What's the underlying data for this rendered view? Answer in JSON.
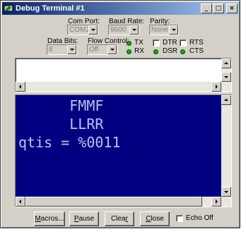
{
  "window": {
    "title": "Debug Terminal #1",
    "controls": {
      "minimize": "_",
      "maximize": "□",
      "close": "×"
    }
  },
  "settings": {
    "com_port": {
      "label": "Com Port:",
      "value": "COM2"
    },
    "baud_rate": {
      "label": "Baud Rate:",
      "value": "9600"
    },
    "parity": {
      "label": "Parity:",
      "value": "None"
    },
    "data_bits": {
      "label": "Data Bits:",
      "value": "8"
    },
    "flow_control": {
      "label": "Flow Control:",
      "value": "Off"
    }
  },
  "indicators": {
    "tx": "TX",
    "rx": "RX",
    "dsr": "DSR",
    "cts": "CTS",
    "led_color": "#00b000"
  },
  "lines": {
    "dtr": "DTR",
    "rts": "RTS"
  },
  "terminal": {
    "background": "#000080",
    "lines": [
      "      FMMF",
      "      LLRR",
      "qtis = %0011"
    ]
  },
  "buttons": {
    "macros": {
      "pre": "",
      "key": "M",
      "post": "acros..."
    },
    "pause": {
      "pre": "",
      "key": "P",
      "post": "ause"
    },
    "clear": {
      "pre": "Clea",
      "key": "r",
      "post": ""
    },
    "close": {
      "pre": "",
      "key": "C",
      "post": "lose"
    }
  },
  "echo_off": "Echo Off"
}
